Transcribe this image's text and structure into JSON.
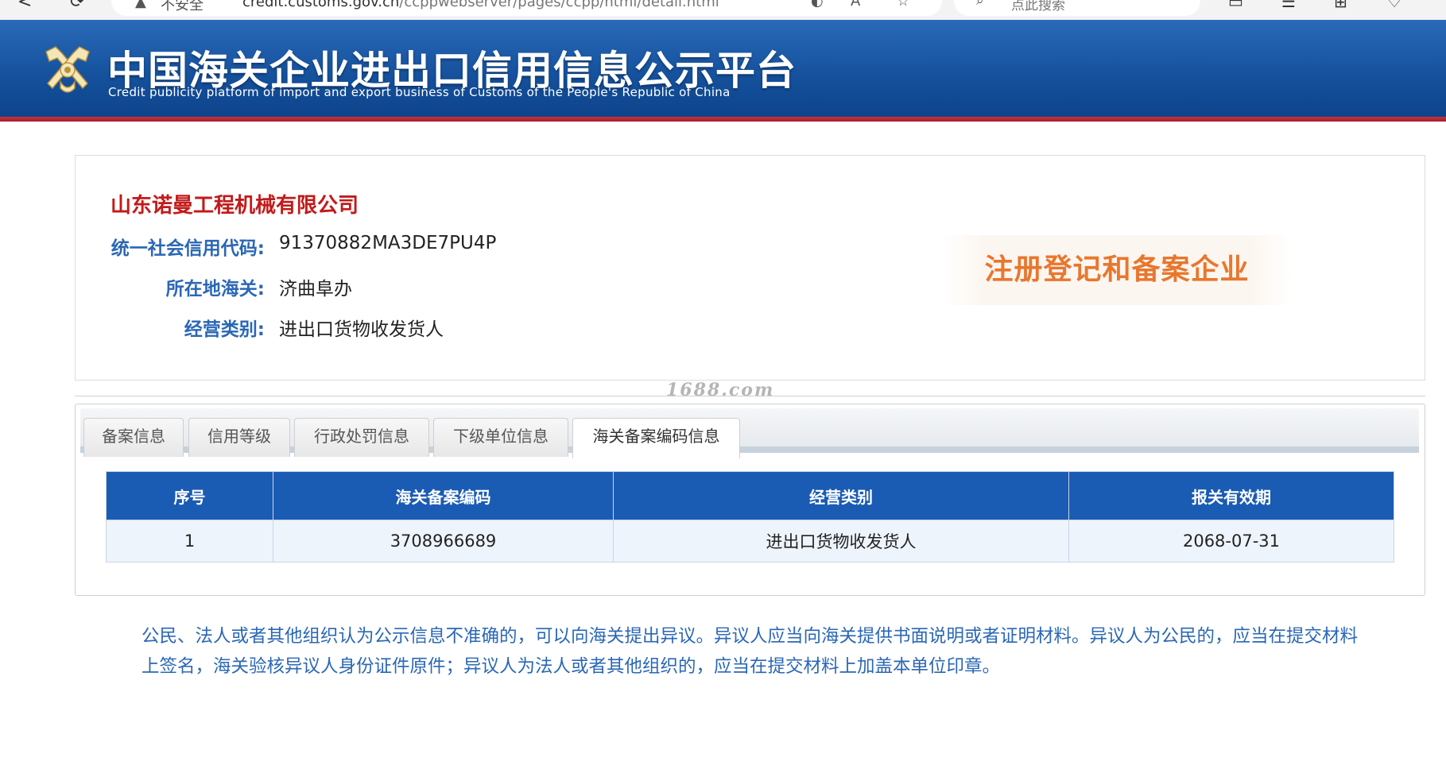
{
  "browser": {
    "back_glyph": "<",
    "refresh_glyph": "⟳",
    "warning_glyph": "▲",
    "security_label": "不安全",
    "url_host": "credit.customs.gov.cn",
    "url_path": "/ccppwebserver/pages/ccpp/html/detail.html",
    "search_placeholder": "点此搜索"
  },
  "header": {
    "title_cn": "中国海关企业进出口信用信息公示平台",
    "title_en": "Credit publicity platform of import and export business of Customs of the People's Republic of China"
  },
  "company": {
    "name": "山东诺曼工程机械有限公司",
    "fields": [
      {
        "label": "统一社会信用代码:",
        "value": "91370882MA3DE7PU4P"
      },
      {
        "label": "所在地海关:",
        "value": "济曲阜办"
      },
      {
        "label": "经营类别:",
        "value": "进出口货物收发货人"
      }
    ],
    "status": "注册登记和备案企业"
  },
  "watermark": "1688.com",
  "tabs": [
    {
      "label": "备案信息"
    },
    {
      "label": "信用等级"
    },
    {
      "label": "行政处罚信息"
    },
    {
      "label": "下级单位信息"
    },
    {
      "label": "海关备案编码信息",
      "active": true
    }
  ],
  "table": {
    "headers": [
      "序号",
      "海关备案编码",
      "经营类别",
      "报关有效期"
    ],
    "rows": [
      [
        "1",
        "3708966689",
        "进出口货物收发货人",
        "2068-07-31"
      ]
    ]
  },
  "notice": "公民、法人或者其他组织认为公示信息不准确的，可以向海关提出异议。异议人应当向海关提供书面说明或者证明材料。异议人为公民的，应当在提交材料上签名，海关验核异议人身份证件原件；异议人为法人或者其他组织的，应当在提交材料上加盖本单位印章。",
  "colors": {
    "header_blue": "#15519d",
    "header_red_line": "#c5313a",
    "company_name_red": "#c31a1a",
    "label_blue": "#2a67b5",
    "status_orange": "#e8772e",
    "table_header": "#1a5bb3",
    "table_row": "#eef4fc"
  }
}
